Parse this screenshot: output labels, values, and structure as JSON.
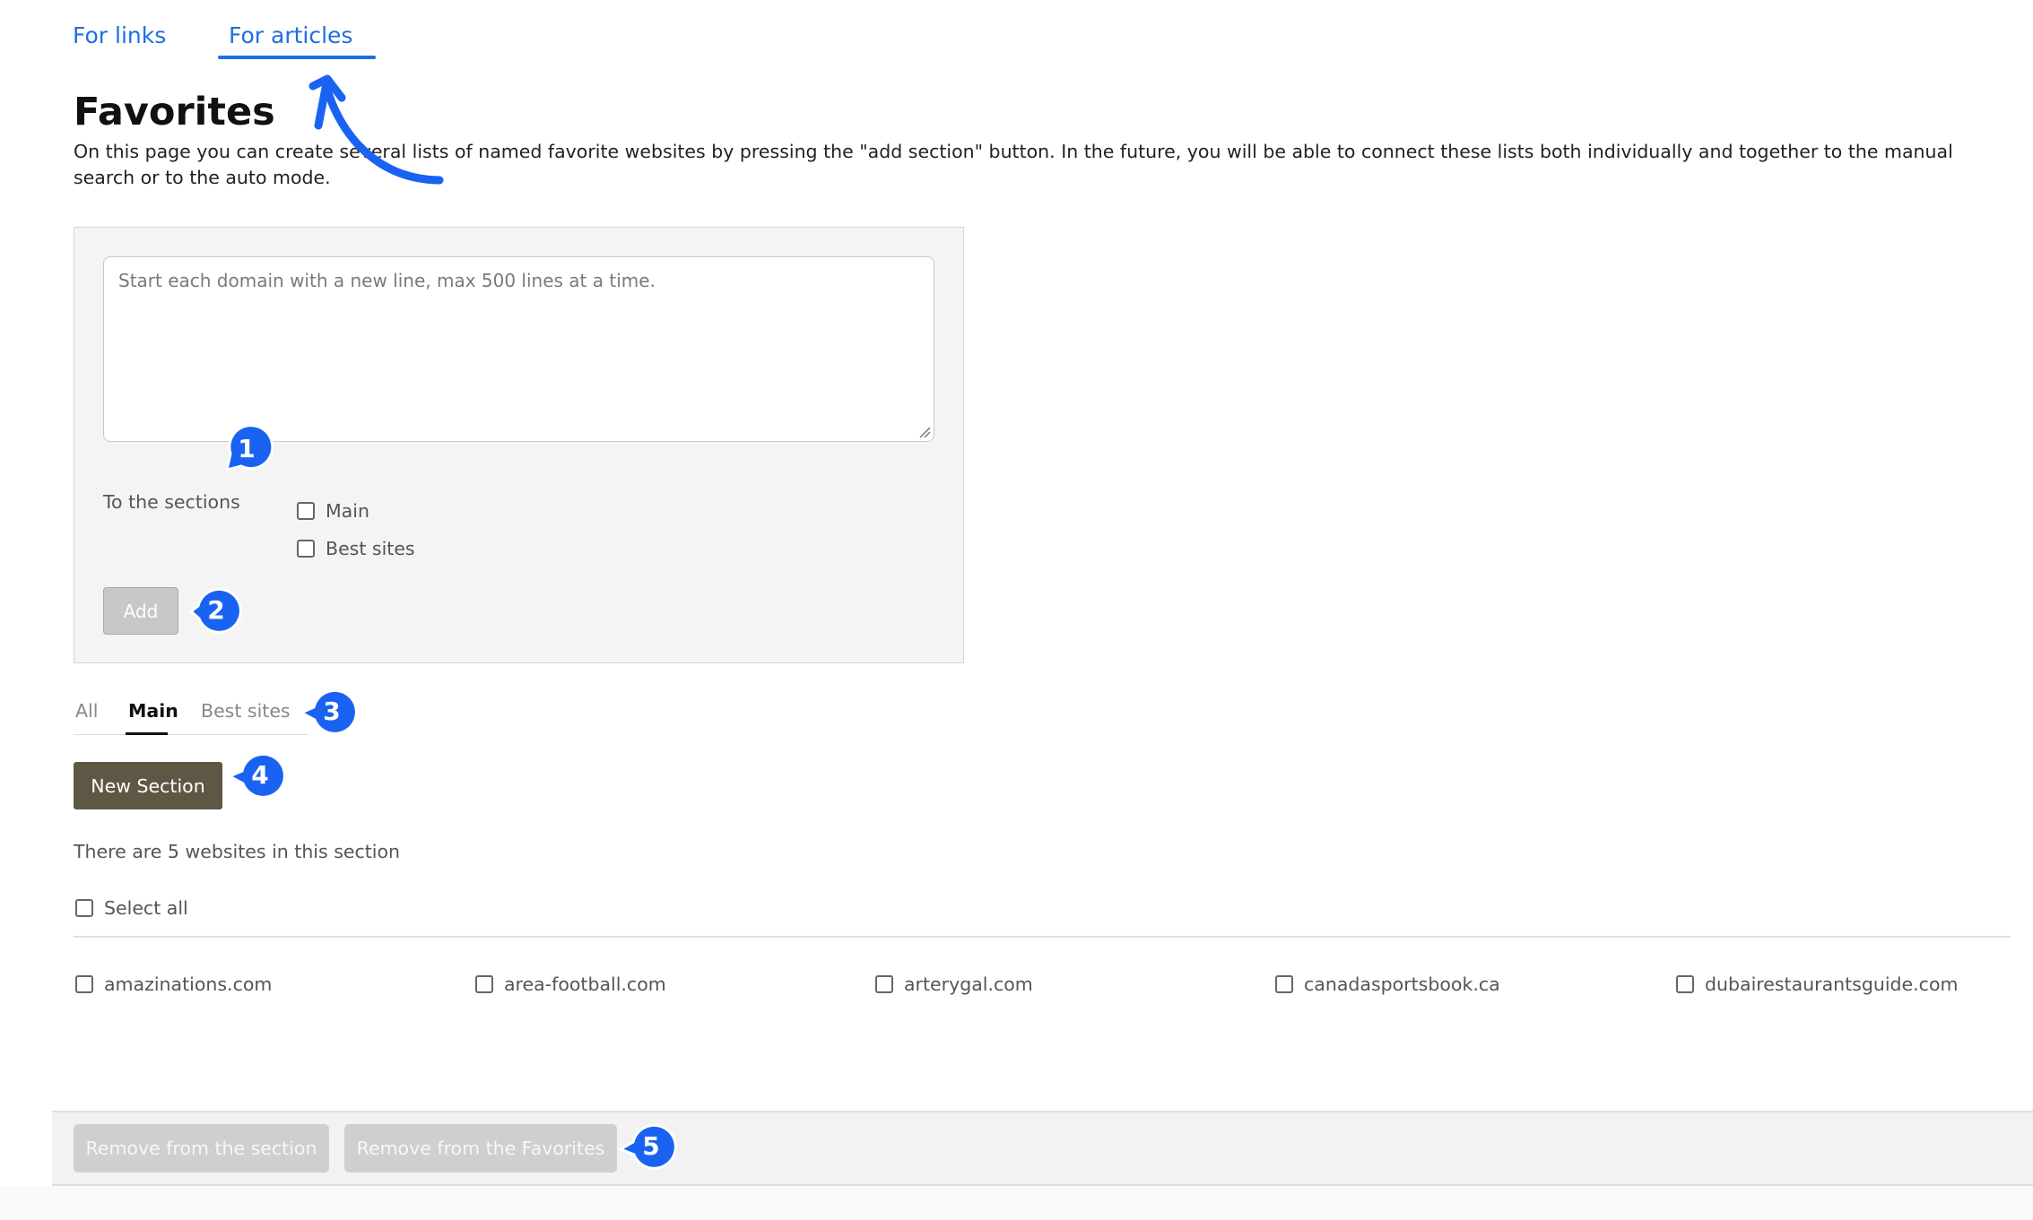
{
  "top_tabs": {
    "links": "For links",
    "articles": "For articles"
  },
  "page": {
    "title": "Favorites",
    "description": "On this page you can create several lists of named favorite websites by pressing the \"add section\" button. In the future, you will be able to connect these lists both individually and together to the manual search or to the auto mode."
  },
  "add_panel": {
    "textarea_placeholder": "Start each domain with a new line, max 500 lines at a time.",
    "sections_label": "To the sections",
    "section_options": [
      "Main",
      "Best sites"
    ],
    "add_button": "Add"
  },
  "section_tabs": {
    "all": "All",
    "main": "Main",
    "best": "Best sites",
    "active": "Main"
  },
  "new_section_button": "New Section",
  "section_info": "There are 5 websites in this section",
  "select_all_label": "Select all",
  "websites": [
    "amazinations.com",
    "area-football.com",
    "arterygal.com",
    "canadasportsbook.ca",
    "dubairestaurantsguide.com"
  ],
  "bottom_actions": {
    "remove_section": "Remove from the section",
    "remove_favorites": "Remove from the Favorites"
  },
  "callouts": [
    "1",
    "2",
    "3",
    "4",
    "5"
  ],
  "colors": {
    "accent_blue": "#1e6fe0",
    "callout_blue": "#1a63f2",
    "new_section_bg": "#5d5744"
  }
}
